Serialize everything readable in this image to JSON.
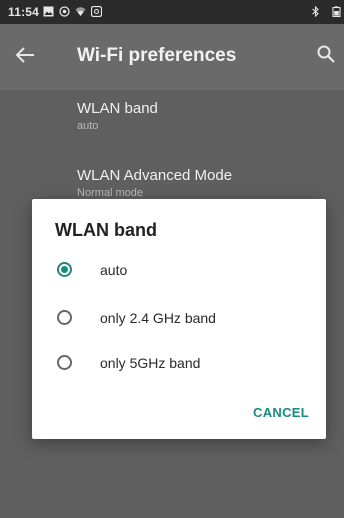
{
  "status_bar": {
    "time": "11:54",
    "icons": [
      "image-icon",
      "camera-icon",
      "wifi-icon",
      "message-icon",
      "bluetooth-icon",
      "battery-icon"
    ]
  },
  "app_bar": {
    "title": "Wi-Fi preferences",
    "back_icon": "back-arrow-icon",
    "search_icon": "search-icon"
  },
  "preferences": [
    {
      "title": "WLAN band",
      "summary": "auto"
    },
    {
      "title": "WLAN Advanced Mode",
      "summary": "Normal mode"
    }
  ],
  "dialog": {
    "title": "WLAN band",
    "options": [
      {
        "label": "auto",
        "selected": true
      },
      {
        "label": "only 2.4 GHz band",
        "selected": false
      },
      {
        "label": "only 5GHz band",
        "selected": false
      }
    ],
    "cancel_label": "CANCEL"
  },
  "colors": {
    "accent": "#1a8a7e",
    "scrim_background": "#5f5f5f",
    "status_bar": "#2b2b2b",
    "dialog_background": "#ffffff"
  }
}
